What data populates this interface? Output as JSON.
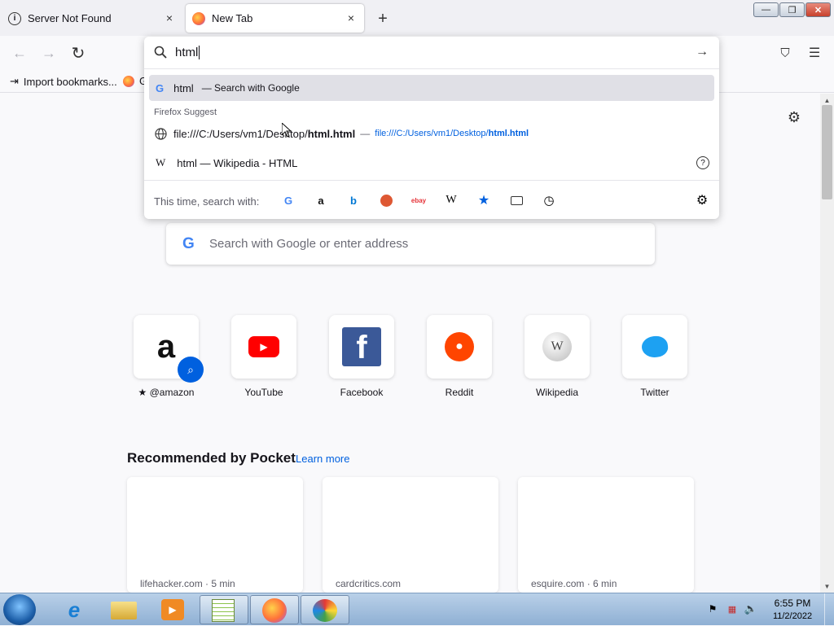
{
  "tabs": [
    {
      "title": "Server Not Found",
      "close": "×"
    },
    {
      "title": "New Tab",
      "close": "×"
    }
  ],
  "new_tab_button": "+",
  "window_controls": {
    "minimize": "—",
    "maximize": "❐",
    "close": "✕"
  },
  "nav": {
    "back": "←",
    "forward": "→",
    "reload": "↻"
  },
  "urlbar": {
    "value": "html",
    "go": "→"
  },
  "toolbar": {
    "pocket": "⛉",
    "menu": "☰"
  },
  "bookmarks": [
    {
      "label": "Import bookmarks..."
    },
    {
      "label": "G"
    }
  ],
  "dropdown": {
    "search_row": {
      "term": "html",
      "suffix": "— Search with Google"
    },
    "section_title": "Firefox Suggest",
    "file_row": {
      "prefix": "file:///C:/Users/vm1/Desktop/",
      "bold": "html.html",
      "dash": "—",
      "url_prefix": "file:///C:/Users/vm1/Desktop/",
      "url_bold": "html.html"
    },
    "wiki_row": {
      "text": "html — Wikipedia - HTML",
      "help": "?"
    },
    "this_time": "This time, search with:",
    "engines": [
      "Google",
      "Amazon",
      "Bing",
      "DuckDuckGo",
      "eBay",
      "Wikipedia",
      "Bookmarks",
      "Tabs",
      "History"
    ]
  },
  "search": {
    "placeholder": "Search with Google or enter address"
  },
  "top_sites": [
    {
      "label": "@amazon",
      "color": "#ff9900"
    },
    {
      "label": "YouTube",
      "color": "#ff0000"
    },
    {
      "label": "Facebook",
      "color": "#3b5998"
    },
    {
      "label": "Reddit",
      "color": "#ff4500"
    },
    {
      "label": "Wikipedia",
      "color": "#888888"
    },
    {
      "label": "Twitter",
      "color": "#1da1f2"
    }
  ],
  "pocket": {
    "heading": "Recommended by Pocket",
    "learn_more": "Learn more",
    "cards": [
      {
        "source": "lifehacker.com · 5 min"
      },
      {
        "source": "cardcritics.com"
      },
      {
        "source": "esquire.com · 6 min"
      }
    ]
  },
  "taskbar": {
    "time": "6:55 PM",
    "date": "11/2/2022"
  },
  "colors": {
    "accent": "#0060df",
    "tab_bg": "#f0f0f4",
    "firefox": "#ff7139"
  }
}
